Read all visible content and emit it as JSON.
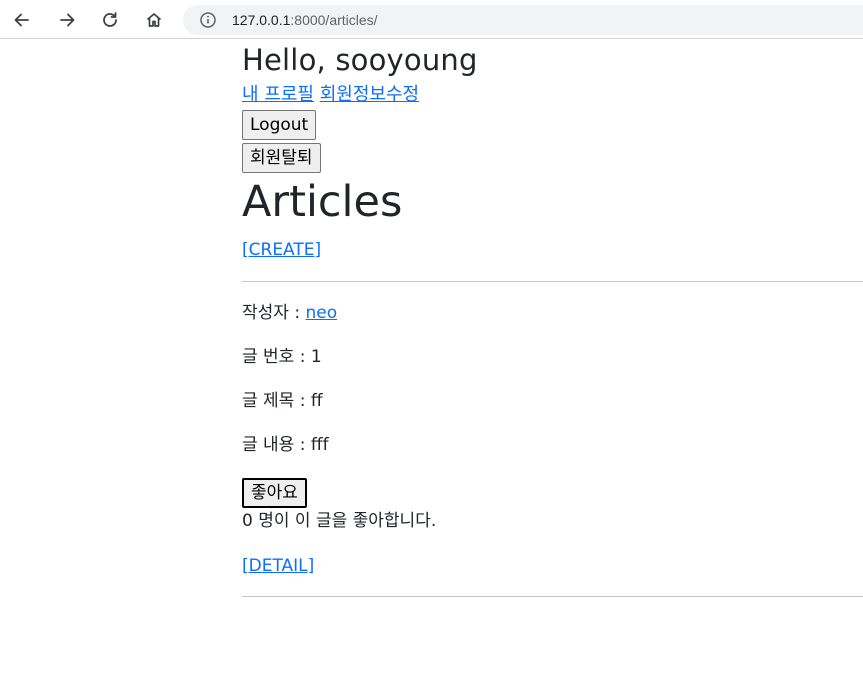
{
  "browser": {
    "url_host": "127.0.0.1",
    "url_rest": ":8000/articles/"
  },
  "header": {
    "greeting": "Hello, sooyoung",
    "profile_link": "내 프로필",
    "edit_link": "회원정보수정",
    "logout_label": "Logout",
    "withdraw_label": "회원탈퇴"
  },
  "main": {
    "title": "Articles",
    "create_link": "[CREATE]"
  },
  "article": {
    "author_label": "작성자 : ",
    "author": "neo",
    "number": "글 번호 : 1",
    "title": "글 제목 : ff",
    "content": "글 내용 : fff",
    "like_label": "좋아요",
    "likes_text": "0 명이 이 글을 좋아합니다.",
    "detail_link": "[DETAIL]"
  }
}
